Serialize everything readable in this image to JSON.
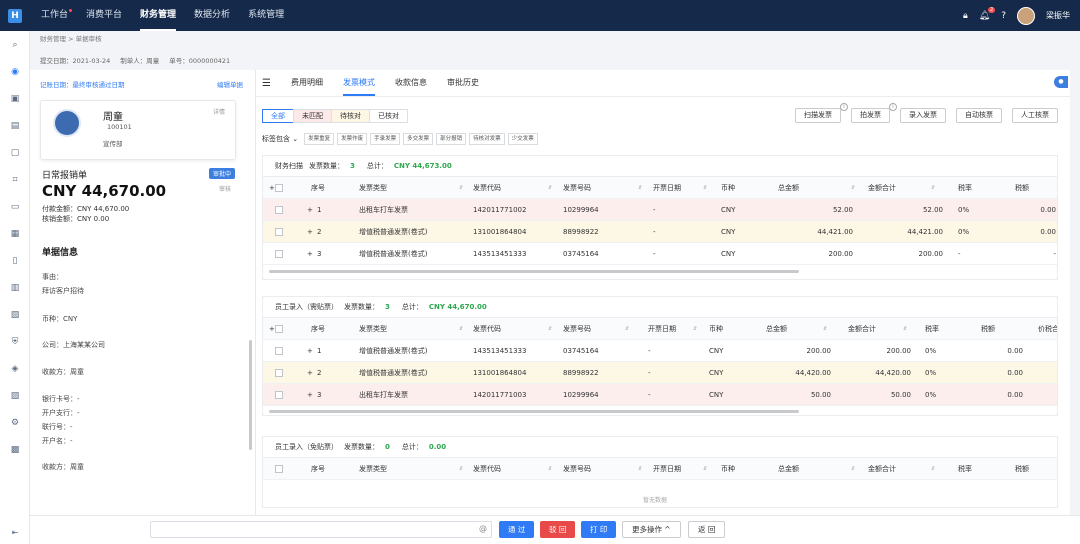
{
  "topbar": {
    "logo": "H",
    "nav": [
      {
        "label": "工作台",
        "dot": true
      },
      {
        "label": "消费平台",
        "dot": false
      },
      {
        "label": "财务管理",
        "dot": false,
        "active": true
      },
      {
        "label": "数据分析",
        "dot": false
      },
      {
        "label": "系统管理",
        "dot": false
      }
    ],
    "notification_badge": "2",
    "username": "梁振华"
  },
  "breadcrumb": [
    "财务管理",
    "单据审核"
  ],
  "meta": {
    "submit_date": "提交日期：2021-03-24",
    "creator": "制单人：周童",
    "doc_no": "单号：0000000421"
  },
  "left_panel": {
    "record_link": "记账日期：最终审核通过日期",
    "edit_link": "编辑单据",
    "user": {
      "name": "周童",
      "id": "100101",
      "dept": "宣传部",
      "detail": "详情"
    },
    "doc_type": "日常报销单",
    "status": "审批中",
    "sub_status": "审核",
    "amount": "CNY 44,670.00",
    "pay_amount": "付款金额：CNY 44,670.00",
    "verify_amount": "核销金额：CNY 0.00",
    "section_title": "单据信息",
    "fields": {
      "reason_label": "事由：",
      "reason": "拜访客户招待",
      "currency": "币种：CNY",
      "company": "公司：上海某某公司",
      "payee": "收款方：周童",
      "bank_card": "银行卡号：-",
      "bank_branch": "开户支行：-",
      "bank_no": "联行号：-",
      "account_name": "开户名：-",
      "payee2": "收款方：周童"
    }
  },
  "main": {
    "tabs": [
      "费用明细",
      "发票模式",
      "收款信息",
      "审批历史"
    ],
    "active_tab": 1,
    "filters": [
      "全部",
      "未匹配",
      "待核对",
      "已核对"
    ],
    "actions": [
      "扫描发票",
      "拍发票",
      "录入发票",
      "自动核票",
      "人工核票"
    ],
    "tag_label": "标签包含",
    "tags": [
      "发票重复",
      "发票作废",
      "手录发票",
      "多交发票",
      "部分报销",
      "待核对发票",
      "少交发票"
    ],
    "columns": [
      "序号",
      "发票类型",
      "发票代码",
      "发票号码",
      "开票日期",
      "币种",
      "总金额",
      "金额合计",
      "税率",
      "税额",
      "价税合"
    ],
    "blocks": [
      {
        "title": "财务扫描",
        "count_label": "发票数量：",
        "count": "3",
        "total_label": "总计：",
        "total": "CNY 44,673.00",
        "rows": [
          {
            "no": "1",
            "type": "出租车打车发票",
            "code": "142011771002",
            "num": "10299964",
            "date": "-",
            "cur": "CNY",
            "total": "52.00",
            "sum": "52.00",
            "rate": "0%",
            "tax": "0.00",
            "hl": "red"
          },
          {
            "no": "2",
            "type": "增值税普通发票(卷式)",
            "code": "131001864804",
            "num": "88998922",
            "date": "-",
            "cur": "CNY",
            "total": "44,421.00",
            "sum": "44,421.00",
            "rate": "0%",
            "tax": "0.00",
            "hl": "yel"
          },
          {
            "no": "3",
            "type": "增值税普通发票(卷式)",
            "code": "143513451333",
            "num": "03745164",
            "date": "-",
            "cur": "CNY",
            "total": "200.00",
            "sum": "200.00",
            "rate": "-",
            "tax": "-",
            "hl": ""
          }
        ]
      },
      {
        "title": "员工录入（需贴票）",
        "count_label": "发票数量：",
        "count": "3",
        "total_label": "总计：",
        "total": "CNY 44,670.00",
        "rows": [
          {
            "no": "1",
            "type": "增值税普通发票(卷式)",
            "code": "143513451333",
            "num": "03745164",
            "date": "-",
            "cur": "CNY",
            "total": "200.00",
            "sum": "200.00",
            "rate": "0%",
            "tax": "0.00",
            "hl": ""
          },
          {
            "no": "2",
            "type": "增值税普通发票(卷式)",
            "code": "131001864804",
            "num": "88998922",
            "date": "-",
            "cur": "CNY",
            "total": "44,420.00",
            "sum": "44,420.00",
            "rate": "0%",
            "tax": "0.00",
            "hl": "yel"
          },
          {
            "no": "3",
            "type": "出租车打车发票",
            "code": "142011771003",
            "num": "10299964",
            "date": "-",
            "cur": "CNY",
            "total": "50.00",
            "sum": "50.00",
            "rate": "0%",
            "tax": "0.00",
            "hl": "red"
          }
        ]
      },
      {
        "title": "员工录入（免贴票）",
        "count_label": "发票数量：",
        "count": "0",
        "total_label": "总计：",
        "total": "0.00",
        "rows": [],
        "empty_text": "暂无数据"
      }
    ]
  },
  "bottom": {
    "buttons": [
      "通 过",
      "驳 回",
      "打 印",
      "更多操作 ^",
      "返 回"
    ]
  }
}
